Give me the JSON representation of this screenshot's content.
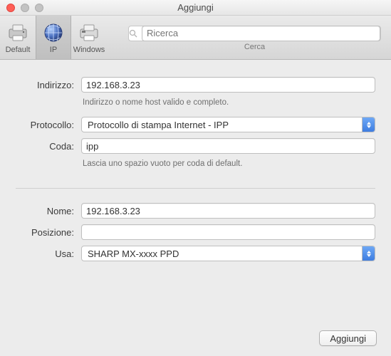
{
  "window": {
    "title": "Aggiungi"
  },
  "toolbar": {
    "default_label": "Default",
    "ip_label": "IP",
    "windows_label": "Windows",
    "search_placeholder": "Ricerca",
    "search_caption": "Cerca"
  },
  "form": {
    "address_label": "Indirizzo:",
    "address_value": "192.168.3.23",
    "address_hint": "Indirizzo o nome host valido e completo.",
    "protocol_label": "Protocollo:",
    "protocol_value": "Protocollo di stampa Internet - IPP",
    "queue_label": "Coda:",
    "queue_value": "ipp",
    "queue_hint": "Lascia uno spazio vuoto per coda di default.",
    "name_label": "Nome:",
    "name_value": "192.168.3.23",
    "location_label": "Posizione:",
    "location_value": "",
    "use_label": "Usa:",
    "use_value": "SHARP MX-xxxx PPD"
  },
  "footer": {
    "add_button_label": "Aggiungi"
  }
}
